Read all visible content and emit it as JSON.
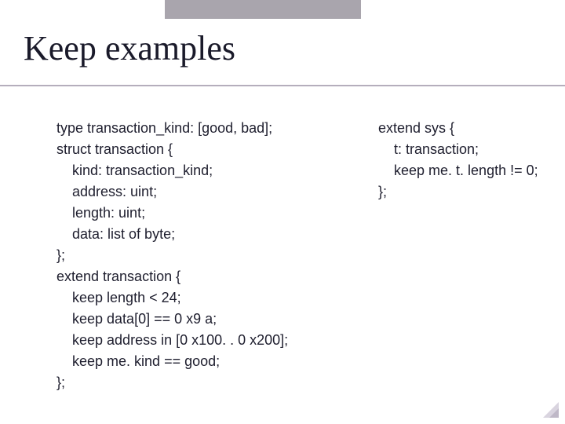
{
  "title": "Keep examples",
  "code": {
    "left": "type transaction_kind: [good, bad];\nstruct transaction {\n    kind: transaction_kind;\n    address: uint;\n    length: uint;\n    data: list of byte;\n};\nextend transaction {\n    keep length < 24;\n    keep data[0] == 0 x9 a;\n    keep address in [0 x100. . 0 x200];\n    keep me. kind == good;\n};",
    "right": "extend sys {\n    t: transaction;\n    keep me. t. length != 0;\n};"
  }
}
